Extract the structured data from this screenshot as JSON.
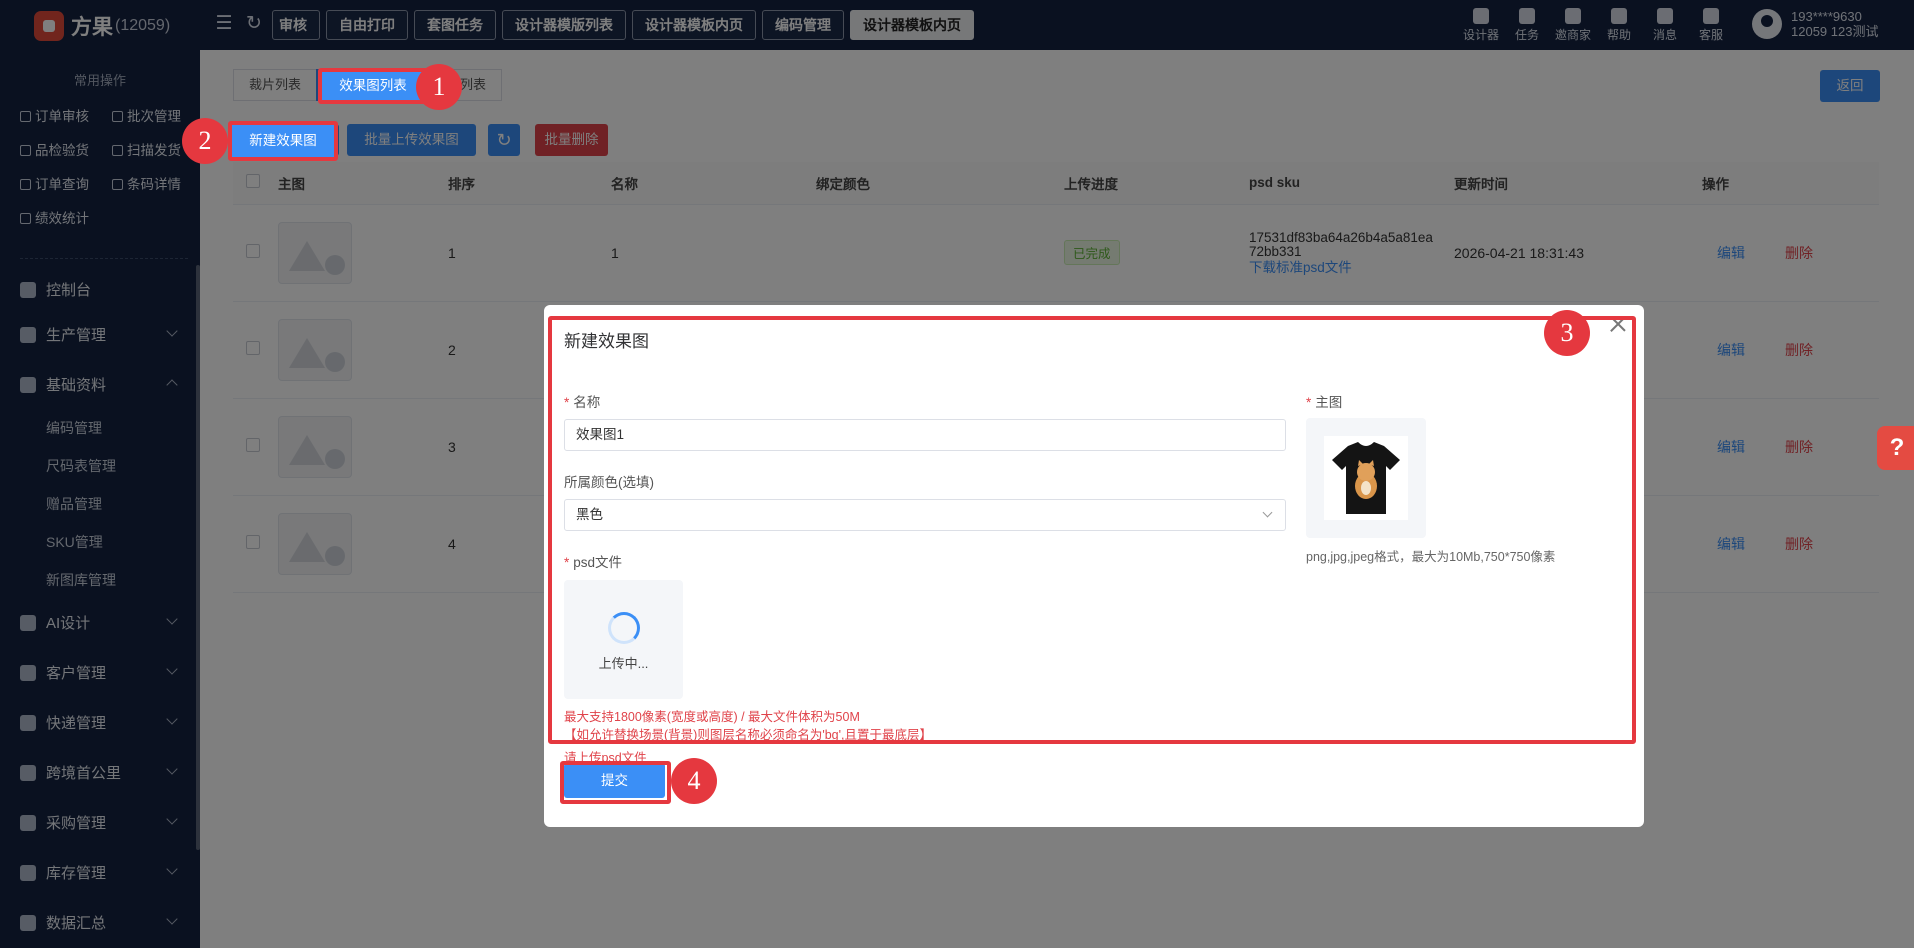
{
  "app": {
    "brand": "方果",
    "org_id": "(12059)"
  },
  "top_tabs": [
    {
      "label": "审核"
    },
    {
      "label": "自由打印"
    },
    {
      "label": "套图任务"
    },
    {
      "label": "设计器模版列表"
    },
    {
      "label": "设计器模板内页"
    },
    {
      "label": "编码管理"
    },
    {
      "label": "设计器模板内页",
      "active": true
    }
  ],
  "top_actions": [
    {
      "label": "设计器",
      "icon": "palette-icon"
    },
    {
      "label": "任务",
      "icon": "task-icon"
    },
    {
      "label": "邀商家",
      "icon": "invite-icon"
    },
    {
      "label": "帮助",
      "icon": "help-icon"
    },
    {
      "label": "消息",
      "icon": "message-icon"
    },
    {
      "label": "客服",
      "icon": "headset-icon"
    }
  ],
  "user": {
    "phone": "193****9630",
    "account": "12059 123测试"
  },
  "sidebar": {
    "quick_title": "常用操作",
    "quick_items": [
      "订单审核",
      "批次管理",
      "品检验货",
      "扫描发货",
      "订单查询",
      "条码详情",
      "绩效统计"
    ],
    "menu": [
      {
        "label": "控制台"
      },
      {
        "label": "生产管理"
      },
      {
        "label": "基础资料",
        "expanded": true
      },
      {
        "label": "AI设计"
      },
      {
        "label": "客户管理"
      },
      {
        "label": "快递管理"
      },
      {
        "label": "跨境首公里"
      },
      {
        "label": "采购管理"
      },
      {
        "label": "库存管理"
      },
      {
        "label": "数据汇总"
      }
    ],
    "sub_items": [
      "编码管理",
      "尺码表管理",
      "赠品管理",
      "SKU管理",
      "新图库管理"
    ]
  },
  "page": {
    "tabs": [
      "裁片列表",
      "效果图列表",
      "图列表"
    ],
    "active_tab": "效果图列表",
    "back_label": "返回",
    "buttons": {
      "new": "新建效果图",
      "batch_upload": "批量上传效果图",
      "batch_delete": "批量删除"
    },
    "columns": [
      "主图",
      "排序",
      "名称",
      "绑定颜色",
      "上传进度",
      "psd sku",
      "更新时间",
      "操作"
    ],
    "rows": [
      {
        "sort": "1",
        "name": "1",
        "progress": "已完成",
        "sku": "17531df83ba64a26b4a5a81ea72bb331",
        "sku_link": "下载标准psd文件",
        "updated": "2026-04-21 18:31:43",
        "edit": "编辑",
        "delete": "删除"
      },
      {
        "sort": "2",
        "edit": "编辑",
        "delete": "删除"
      },
      {
        "sort": "3",
        "edit": "编辑",
        "delete": "删除"
      },
      {
        "sort": "4",
        "edit": "编辑",
        "delete": "删除"
      }
    ]
  },
  "modal": {
    "title": "新建效果图",
    "name_label": "名称",
    "name_value": "效果图1",
    "color_label": "所属颜色(选填)",
    "color_value": "黑色",
    "psd_label": "psd文件",
    "uploading": "上传中...",
    "hint1": "最大支持1800像素(宽度或高度) / 最大文件体积为50M",
    "hint2": "【如允许替换场景(背景)则图层名称必须命名为'bg',且置于最底层】",
    "error": "请上传psd文件",
    "main_image_label": "主图",
    "image_hint": "png,jpg,jpeg格式，最大为10Mb,750*750像素",
    "submit": "提交"
  },
  "annotations": [
    "1",
    "2",
    "3",
    "4"
  ],
  "colors": {
    "primary": "#3b8ff6",
    "danger": "#e0434a",
    "nav": "#142241",
    "annotation": "#e5383f"
  }
}
